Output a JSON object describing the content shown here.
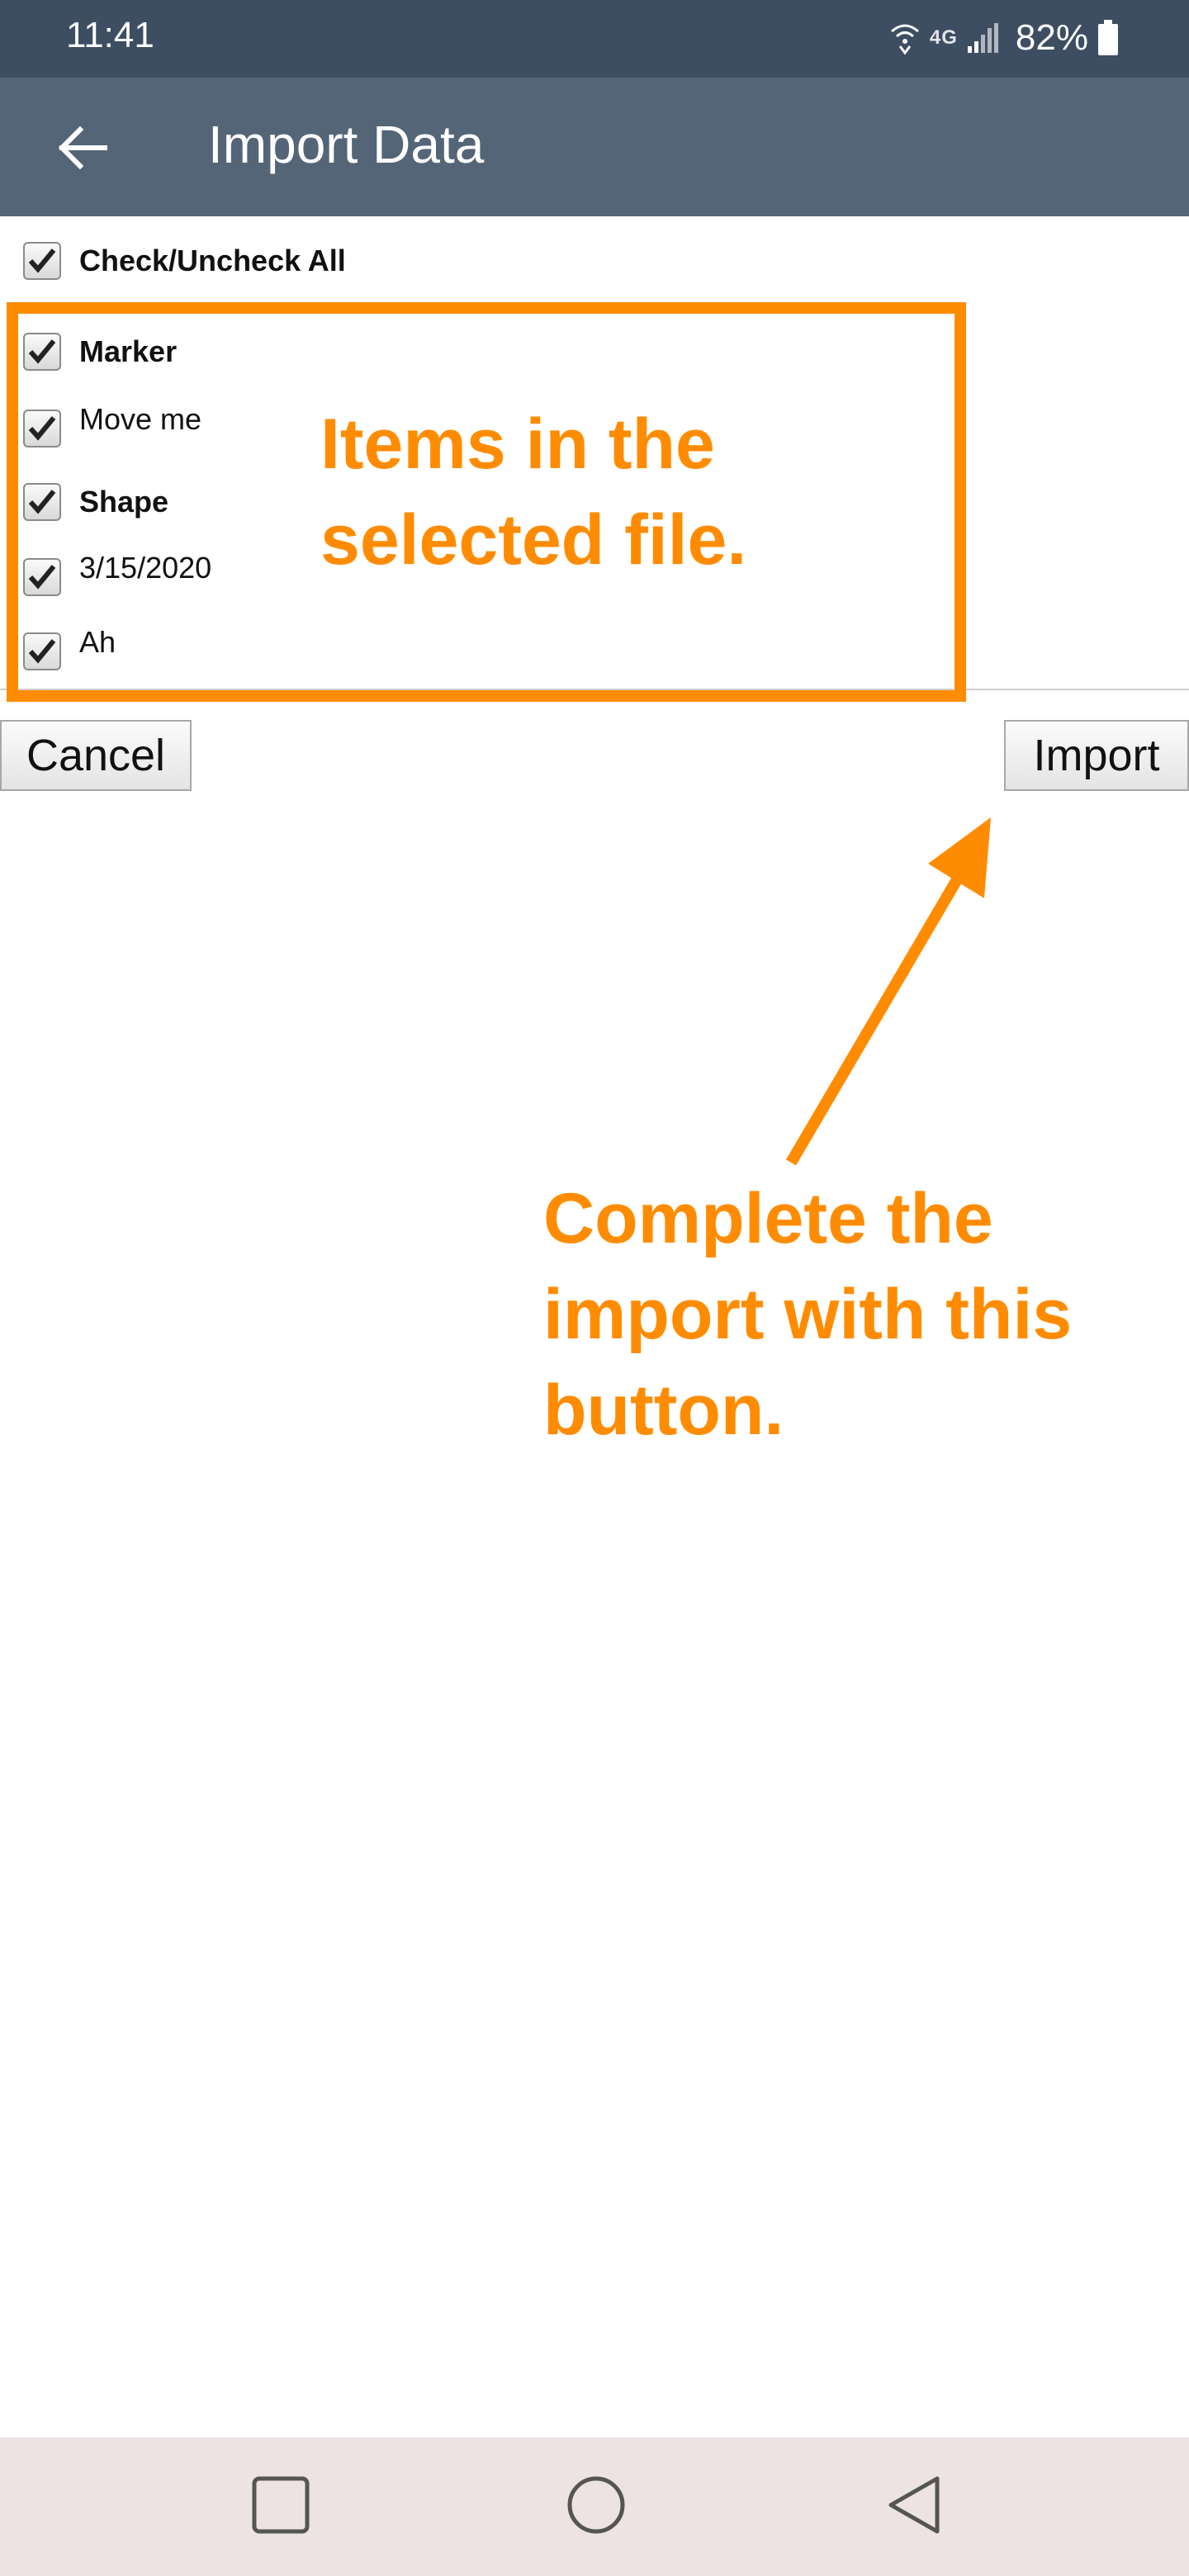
{
  "status_bar": {
    "time": "11:41",
    "network": "4G",
    "battery": "82%",
    "icons": [
      "wifi-calling-icon",
      "network-4g-icon",
      "signal-icon",
      "battery-icon"
    ]
  },
  "app_bar": {
    "title": "Import Data",
    "back_icon": "arrow-left-icon"
  },
  "import_list": {
    "check_all": {
      "label": "Check/Uncheck All",
      "checked": true
    },
    "items": [
      {
        "label": "Marker",
        "bold": true,
        "checked": true
      },
      {
        "label": "Move me",
        "bold": false,
        "checked": true
      },
      {
        "label": "Shape",
        "bold": true,
        "checked": true
      },
      {
        "label": "3/15/2020",
        "bold": false,
        "checked": true
      },
      {
        "label": "Ah",
        "bold": false,
        "checked": true
      }
    ]
  },
  "buttons": {
    "cancel": "Cancel",
    "import": "Import"
  },
  "annotations": {
    "color": "#ff8c00",
    "items_note_line1": "Items in the",
    "items_note_line2": "selected file.",
    "import_note_line1": "Complete the",
    "import_note_line2": "import with this",
    "import_note_line3": "button."
  },
  "nav_bar": {
    "icons": [
      "recent-apps-icon",
      "home-icon",
      "back-icon"
    ]
  },
  "colors": {
    "status_bar": "#3d4d62",
    "app_bar": "#546577",
    "nav_bar": "#ede3e2",
    "accent": "#ff8c00"
  }
}
